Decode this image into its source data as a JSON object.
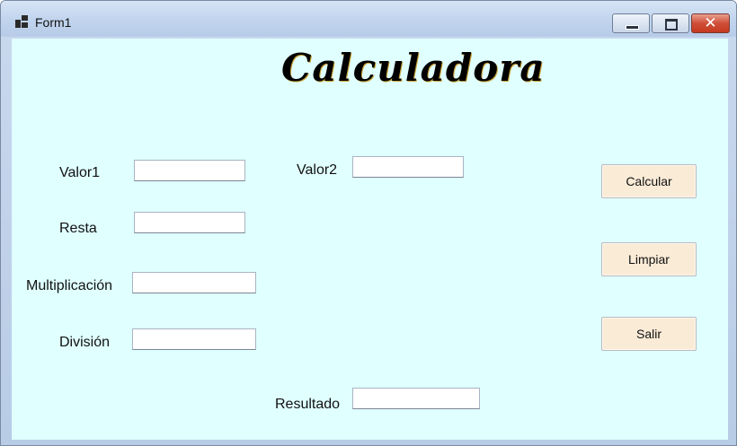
{
  "window": {
    "title": "Form1",
    "controls": {
      "minimize_icon": "minimize-icon",
      "maximize_icon": "maximize-icon",
      "close_icon": "close-icon",
      "close_glyph": "✕"
    }
  },
  "form": {
    "heading": "Calculadora",
    "background": "#e0ffff",
    "labels": {
      "valor1": "Valor1",
      "valor2": "Valor2",
      "resta": "Resta",
      "multiplicacion": "Multiplicación",
      "division": "División",
      "resultado": "Resultado"
    },
    "fields": {
      "valor1": "",
      "valor2": "",
      "resta": "",
      "multiplicacion": "",
      "division": "",
      "resultado": ""
    },
    "buttons": {
      "calcular": "Calcular",
      "limpiar": "Limpiar",
      "salir": "Salir",
      "color": "#faebd7"
    }
  }
}
